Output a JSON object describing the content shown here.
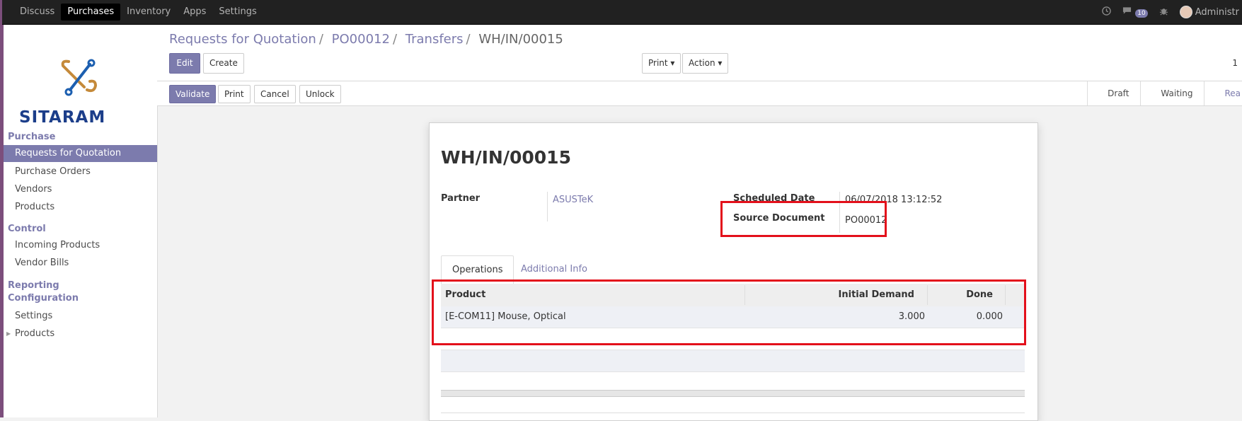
{
  "topbar": {
    "menu": [
      {
        "label": "Discuss",
        "active": false
      },
      {
        "label": "Purchases",
        "active": true
      },
      {
        "label": "Inventory",
        "active": false
      },
      {
        "label": "Apps",
        "active": false
      },
      {
        "label": "Settings",
        "active": false
      }
    ],
    "message_count": "10",
    "user": "Administr"
  },
  "sidebar": {
    "logo_text": "SITARAM",
    "sections": {
      "purchase": "Purchase",
      "control": "Control",
      "reporting": "Reporting",
      "configuration": "Configuration"
    },
    "items": {
      "rfq": "Requests for Quotation",
      "purchase_orders": "Purchase Orders",
      "vendors": "Vendors",
      "products": "Products",
      "incoming_products": "Incoming Products",
      "vendor_bills": "Vendor Bills",
      "settings": "Settings",
      "config_products": "Products"
    },
    "colors": {
      "accent": "#7c7bad"
    }
  },
  "breadcrumb": {
    "items": [
      "Requests for Quotation",
      "PO00012",
      "Transfers"
    ],
    "current": "WH/IN/00015",
    "separator": "/"
  },
  "toolbar": {
    "edit": "Edit",
    "create": "Create",
    "print": "Print ▾",
    "action": "Action ▾",
    "pager": "1"
  },
  "statusbar": {
    "validate": "Validate",
    "print": "Print",
    "cancel": "Cancel",
    "unlock": "Unlock",
    "states": [
      "Draft",
      "Waiting",
      "Rea"
    ]
  },
  "form": {
    "title": "WH/IN/00015",
    "partner_label": "Partner",
    "partner_value": "ASUSTeK",
    "scheduled_label": "Scheduled Date",
    "scheduled_value": "06/07/2018 13:12:52",
    "source_label": "Source Document",
    "source_value": "PO00012",
    "tabs": {
      "operations": "Operations",
      "additional": "Additional Info"
    },
    "table": {
      "headers": {
        "product": "Product",
        "demand": "Initial Demand",
        "done": "Done"
      },
      "rows": [
        {
          "product": "[E-COM11] Mouse, Optical",
          "demand": "3.000",
          "done": "0.000"
        }
      ]
    }
  },
  "highlight_color": "#e3101b"
}
